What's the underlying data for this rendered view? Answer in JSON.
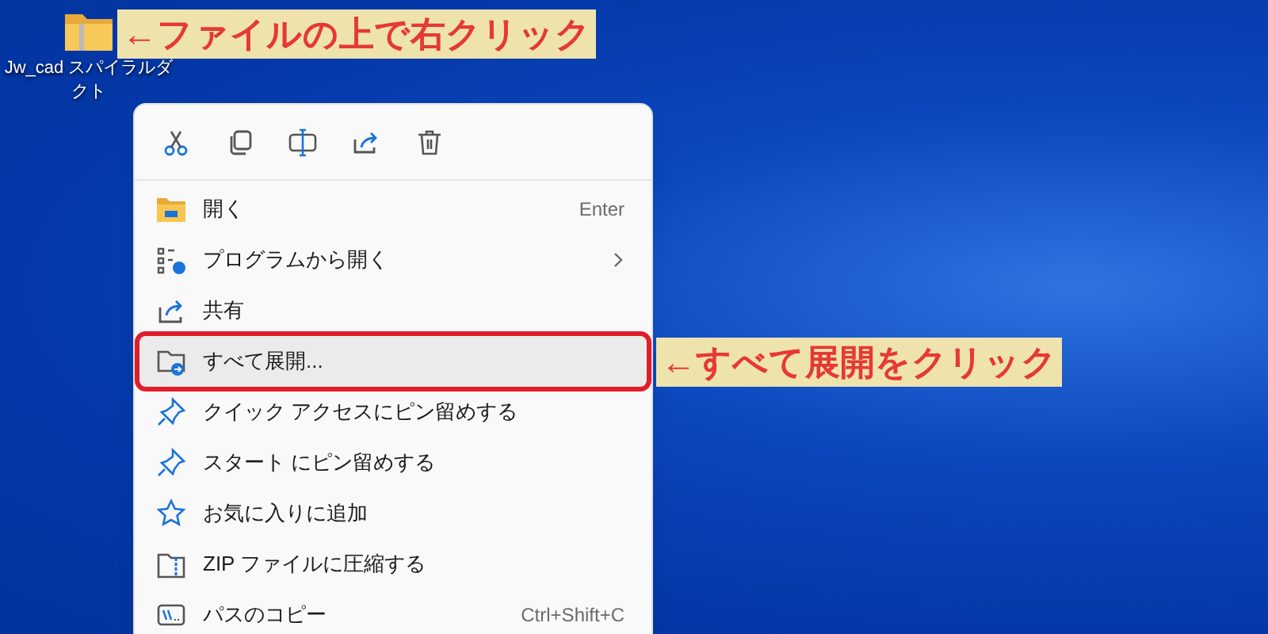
{
  "desktop_icon": {
    "label": "Jw_cad スパイラルダクト"
  },
  "callouts": [
    {
      "text": "←ファイルの上で右クリック"
    },
    {
      "text": "←すべて展開をクリック"
    }
  ],
  "context_menu": {
    "items": [
      {
        "label": "開く",
        "shortcut": "Enter",
        "submenu": false,
        "selected": false
      },
      {
        "label": "プログラムから開く",
        "submenu": true,
        "selected": false
      },
      {
        "label": "共有",
        "submenu": false,
        "selected": false
      },
      {
        "label": "すべて展開...",
        "submenu": false,
        "selected": true
      },
      {
        "label": "クイック アクセスにピン留めする",
        "submenu": false,
        "selected": false
      },
      {
        "label": "スタート にピン留めする",
        "submenu": false,
        "selected": false
      },
      {
        "label": "お気に入りに追加",
        "submenu": false,
        "selected": false
      },
      {
        "label": "ZIP ファイルに圧縮する",
        "submenu": false,
        "selected": false
      },
      {
        "label": "パスのコピー",
        "shortcut": "Ctrl+Shift+C",
        "submenu": false,
        "selected": false
      }
    ]
  }
}
